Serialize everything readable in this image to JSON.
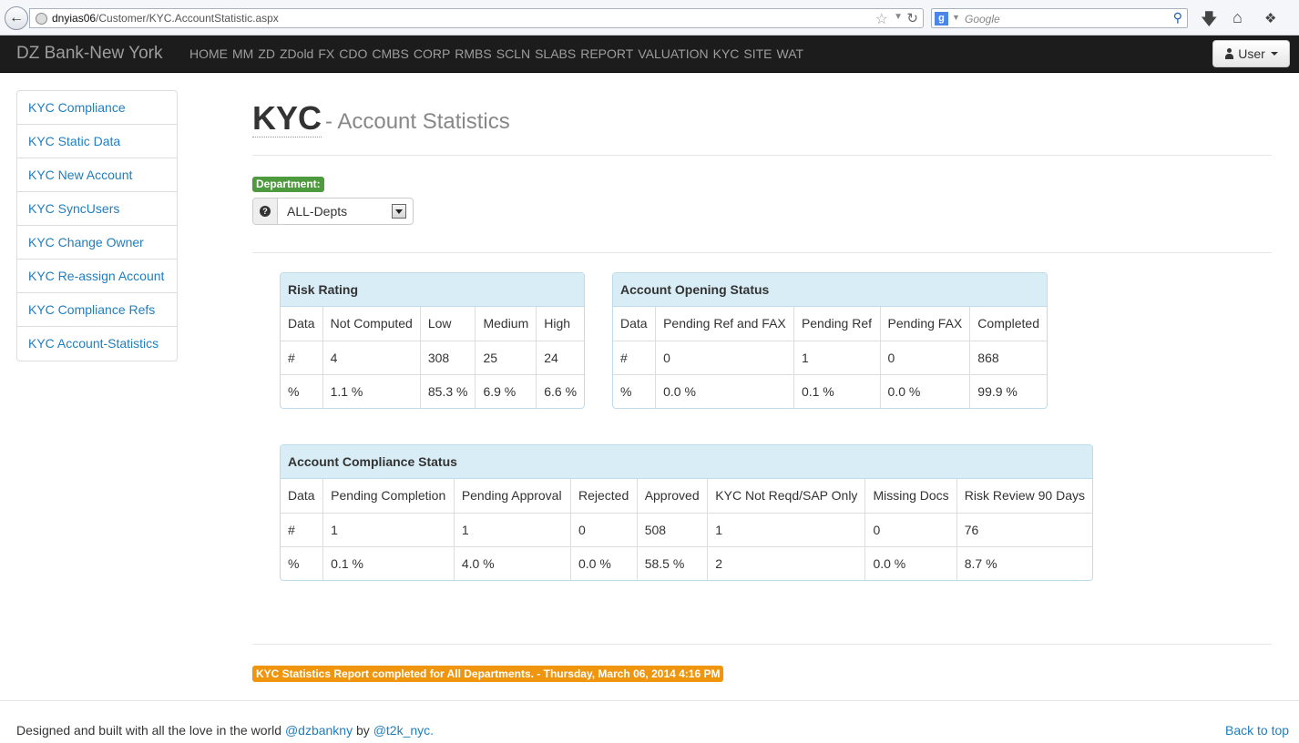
{
  "browser": {
    "url_host": "dnyias06",
    "url_path": "/Customer/KYC.AccountStatistic.aspx",
    "search_placeholder": "Google"
  },
  "navbar": {
    "brand": "DZ Bank-New York",
    "links": [
      "HOME",
      "MM",
      "ZD",
      "ZDold",
      "FX",
      "CDO",
      "CMBS",
      "CORP",
      "RMBS",
      "SCLN",
      "SLABS",
      "REPORT",
      "VALUATION",
      "KYC",
      "SITE",
      "WAT"
    ],
    "user_label": "User"
  },
  "sidebar": {
    "items": [
      {
        "label": "KYC Compliance"
      },
      {
        "label": "KYC Static Data"
      },
      {
        "label": "KYC New Account"
      },
      {
        "label": "KYC SyncUsers"
      },
      {
        "label": "KYC Change Owner"
      },
      {
        "label": "KYC Re-assign Account"
      },
      {
        "label": "KYC Compliance Refs"
      },
      {
        "label": "KYC Account-Statistics"
      }
    ]
  },
  "header": {
    "title": "KYC",
    "subtitle": "- Account Statistics"
  },
  "department": {
    "label": "Department:",
    "selected": "ALL-Depts"
  },
  "risk_rating": {
    "title": "Risk Rating",
    "rows": [
      [
        "Data",
        "Not Computed",
        "Low",
        "Medium",
        "High"
      ],
      [
        "#",
        "4",
        "308",
        "25",
        "24"
      ],
      [
        "%",
        "1.1 %",
        "85.3 %",
        "6.9 %",
        "6.6 %"
      ]
    ]
  },
  "account_opening": {
    "title": "Account Opening Status",
    "rows": [
      [
        "Data",
        "Pending Ref and FAX",
        "Pending Ref",
        "Pending FAX",
        "Completed"
      ],
      [
        "#",
        "0",
        "1",
        "0",
        "868"
      ],
      [
        "%",
        "0.0 %",
        "0.1 %",
        "0.0 %",
        "99.9 %"
      ]
    ]
  },
  "account_compliance": {
    "title": "Account Compliance Status",
    "rows": [
      [
        "Data",
        "Pending Completion",
        "Pending Approval",
        "Rejected",
        "Approved",
        "KYC Not Reqd/SAP Only",
        "Missing Docs",
        "Risk Review 90 Days"
      ],
      [
        "#",
        "1",
        "1",
        "0",
        "508",
        "1",
        "0",
        "76"
      ],
      [
        "%",
        "0.1 %",
        "4.0 %",
        "0.0 %",
        "58.5 %",
        "2",
        "0.0 %",
        "8.7 %"
      ]
    ]
  },
  "status": {
    "message": "KYC Statistics Report completed for All Departments. - Thursday, March 06, 2014 4:16 PM"
  },
  "footer": {
    "text_prefix": "Designed and built with all the love in the world ",
    "link1": "@dzbankny",
    "by": " by ",
    "link2": "@t2k_nyc.",
    "back_to_top": "Back to top"
  },
  "colors": {
    "navbar_bg": "#1c1c1c",
    "link": "#1e7ebf",
    "panel_heading": "#d9edf7",
    "department_badge": "#4e9a3f",
    "status_label": "#f0960e"
  }
}
